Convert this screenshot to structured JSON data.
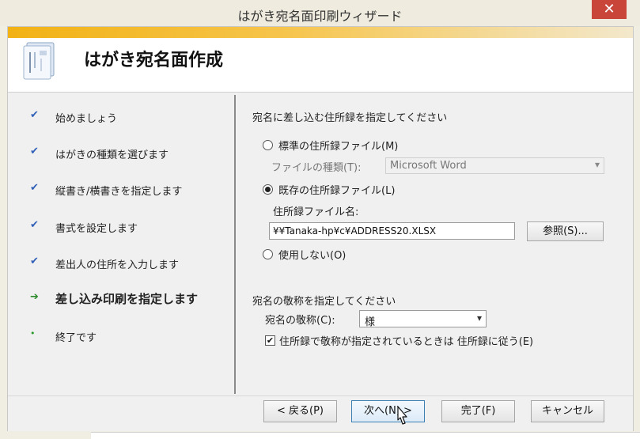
{
  "window": {
    "title": "はがき宛名面印刷ウィザード",
    "close_label": "✕"
  },
  "header": {
    "title": "はがき宛名面作成"
  },
  "steps": [
    {
      "label": "始めましょう",
      "state": "done",
      "mark": "✔"
    },
    {
      "label": "はがきの種類を選びます",
      "state": "done",
      "mark": "✔"
    },
    {
      "label": "縦書き/横書きを指定します",
      "state": "done",
      "mark": "✔"
    },
    {
      "label": "書式を設定します",
      "state": "done",
      "mark": "✔"
    },
    {
      "label": "差出人の住所を入力します",
      "state": "done",
      "mark": "✔"
    },
    {
      "label": "差し込み印刷を指定します",
      "state": "current",
      "mark": "➔"
    },
    {
      "label": "終了です",
      "state": "pending",
      "mark": "•"
    }
  ],
  "address_section": {
    "heading": "宛名に差し込む住所録を指定してください",
    "option_standard": "標準の住所録ファイル(M)",
    "file_type_label": "ファイルの種類(T):",
    "file_type_value": "Microsoft Word",
    "option_existing": "既存の住所録ファイル(L)",
    "file_name_label": "住所録ファイル名:",
    "file_name_value": "¥¥Tanaka-hp¥c¥ADDRESS20.XLSX",
    "browse_label": "参照(S)...",
    "option_none": "使用しない(O)",
    "selected_option": "existing"
  },
  "honorific_section": {
    "heading": "宛名の敬称を指定してください",
    "honorific_label": "宛名の敬称(C):",
    "honorific_value": "様",
    "checkbox_label": "住所録で敬称が指定されているときは 住所録に従う(E)",
    "checkbox_checked": true
  },
  "footer": {
    "back_label": "< 戻る(P)",
    "next_label": "次へ(N) >",
    "finish_label": "完了(F)",
    "cancel_label": "キャンセル"
  },
  "colors": {
    "accent_bar": "#f2b214",
    "close_button": "#c9453a",
    "check_mark": "#2f5fb8",
    "current_arrow": "#2a8a2a"
  }
}
